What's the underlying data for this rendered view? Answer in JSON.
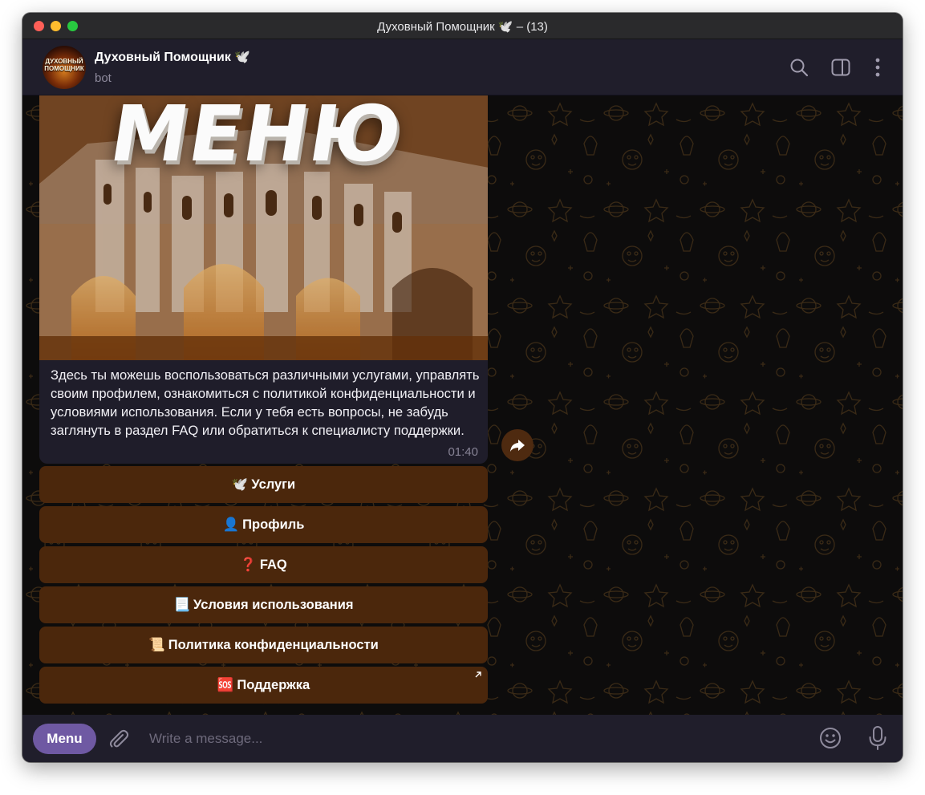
{
  "window": {
    "title": "Духовный Помощник 🕊️ – (13)"
  },
  "header": {
    "avatar_text": "ДУХОВНЫЙ ПОМОЩНИК",
    "name": "Духовный Помощник 🕊️",
    "status": "bot",
    "icons": [
      "search-icon",
      "sidebar-toggle-icon",
      "more-icon"
    ]
  },
  "message": {
    "image_title": "МЕНЮ",
    "text": "Здесь ты можешь воспользоваться различными услугами, управлять своим профилем, ознакомиться с политикой конфиденциальности и условиями использования. Если у тебя есть вопросы, не забудь заглянуть в раздел FAQ или обратиться к специалисту поддержки.",
    "time": "01:40"
  },
  "keyboard": [
    {
      "emoji": "🕊️",
      "label": "Услуги"
    },
    {
      "emoji": "👤",
      "label": "Профиль"
    },
    {
      "emoji": "❓",
      "label": "FAQ"
    },
    {
      "emoji": "📃",
      "label": "Условия использования"
    },
    {
      "emoji": "📜",
      "label": "Политика конфиденциальности"
    },
    {
      "emoji": "🆘",
      "label": "Поддержка"
    }
  ],
  "composer": {
    "menu_label": "Menu",
    "placeholder": "Write a message..."
  },
  "colors": {
    "chat_background": "#0d0c0c",
    "header": "#201e2b",
    "keyboard_button": "#4b270c",
    "menu_button": "#6f59a3",
    "pattern": "#3a2a16"
  }
}
